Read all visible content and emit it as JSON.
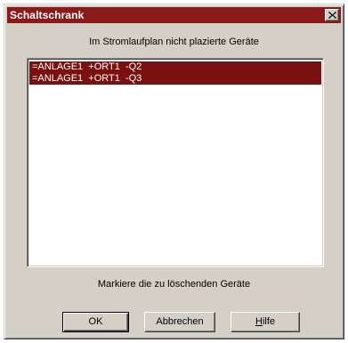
{
  "window": {
    "title": "Schaltschrank",
    "close_icon": "close-icon"
  },
  "heading": "Im Stromlaufplan nicht plazierte Geräte",
  "list": {
    "items": [
      "=ANLAGE1  +ORT1  -Q2",
      "=ANLAGE1  +ORT1  -Q3"
    ],
    "selected_color": "#7a1010"
  },
  "hint": "Markiere die zu löschenden Geräte",
  "buttons": {
    "ok": "OK",
    "cancel": "Abbrechen",
    "help": "Hilfe"
  },
  "colors": {
    "titlebar": "#8a1a1a",
    "face": "#d4d0c8"
  }
}
